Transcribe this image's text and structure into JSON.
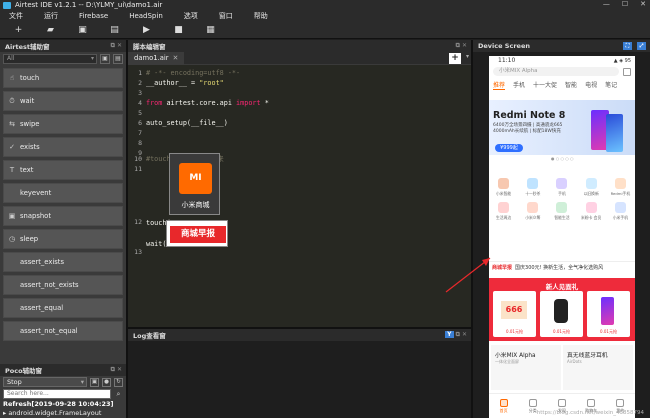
{
  "window": {
    "title": "Airtest IDE v1.2.1 -- D:\\YLMY_ui\\damo1.air"
  },
  "menu": [
    "文件",
    "运行",
    "Firebase",
    "HeadSpin",
    "选项",
    "窗口",
    "帮助"
  ],
  "airtest_panel": {
    "title": "Airtest辅助窗",
    "filter_value": "All",
    "apis": [
      {
        "label": "touch",
        "icon": "☝"
      },
      {
        "label": "wait",
        "icon": "⏱"
      },
      {
        "label": "swipe",
        "icon": "⇆"
      },
      {
        "label": "exists",
        "icon": "✓"
      },
      {
        "label": "text",
        "icon": "T"
      },
      {
        "label": "keyevent",
        "icon": ""
      },
      {
        "label": "snapshot",
        "icon": "▣"
      },
      {
        "label": "sleep",
        "icon": "◷"
      },
      {
        "label": "assert_exists",
        "icon": ""
      },
      {
        "label": "assert_not_exists",
        "icon": ""
      },
      {
        "label": "assert_equal",
        "icon": ""
      },
      {
        "label": "assert_not_equal",
        "icon": ""
      }
    ]
  },
  "poco_panel": {
    "title": "Poco辅助窗",
    "mode": "Stop",
    "search_placeholder": "Search here...",
    "refresh": "Refresh[2019-09-28 10:04:23]",
    "tree_item": "▸ android.widget.FrameLayout"
  },
  "editor": {
    "title": "脚本编辑窗",
    "tab": "damo1.air",
    "lines": [
      "1",
      "2",
      "3",
      "4",
      "5",
      "6",
      "7",
      "8",
      "9",
      "10",
      "11",
      "12",
      "13"
    ],
    "code": {
      "l1": "# -*- encoding=utf8 -*-",
      "l2a": "__author__ = ",
      "l2b": "\"root\"",
      "l4a": "from",
      "l4b": " airtest.core.api ",
      "l4c": "import",
      "l4d": " *",
      "l6": "auto_setup(__file__)",
      "l10": "#touch将APP图标唤起来",
      "l12": "touch(",
      "l12b": ")",
      "l13": "wait("
    },
    "img1_logo": "MI",
    "img1_label": "小米商城",
    "img2_label": "商城早报"
  },
  "log_panel": {
    "title": "Log查看窗"
  },
  "device": {
    "title": "Device Screen",
    "status_time": "11:10",
    "status_right": "▲ ◈ 95",
    "search_text": "小米MIX Alpha",
    "tabs": [
      "推荐",
      "手机",
      "十一大促",
      "智能",
      "电视",
      "笔记"
    ],
    "banner_title": "Redmi Note 8",
    "banner_sub": "6400万全场景四摄 | 高通骁龙665 4000mAh长续航 | 标配18W快充",
    "banner_price": "¥999起",
    "grid": [
      {
        "label": "小米智能",
        "color": "#f7c8b0"
      },
      {
        "label": "十一秒杀",
        "color": "#bfe3ff"
      },
      {
        "label": "手机",
        "color": "#d9d0ff"
      },
      {
        "label": "以旧换新",
        "color": "#d0ecff"
      },
      {
        "label": "Redmi手机",
        "color": "#ffe0c8"
      },
      {
        "label": "生活周边",
        "color": "#ffd2d2"
      },
      {
        "label": "小米众筹",
        "color": "#ffd8cc"
      },
      {
        "label": "智能生活",
        "color": "#cfefd8"
      },
      {
        "label": "米粉卡 会员",
        "color": "#ffd1e3"
      },
      {
        "label": "小米手机",
        "color": "#d6e4ff"
      }
    ],
    "news_tag": "商城早报",
    "news_text": "国庆300元! 换新生活，全气净化选购风",
    "red_title": "新人见面礼",
    "card1_big": "666",
    "card1_caption": "0.01元抢",
    "card2_caption": "0.01元抢",
    "card3_caption": "0.01元抢",
    "promo1_title": "小米MIX Alpha",
    "promo1_sub": "一体化全面屏",
    "promo2_title": "真无线蓝牙耳机",
    "promo2_sub": "AirDots",
    "nav": [
      "首页",
      "分类",
      "发现",
      "购物车",
      "我的"
    ]
  },
  "watermark": "https://blog.csdn.net/weixin_43858794"
}
